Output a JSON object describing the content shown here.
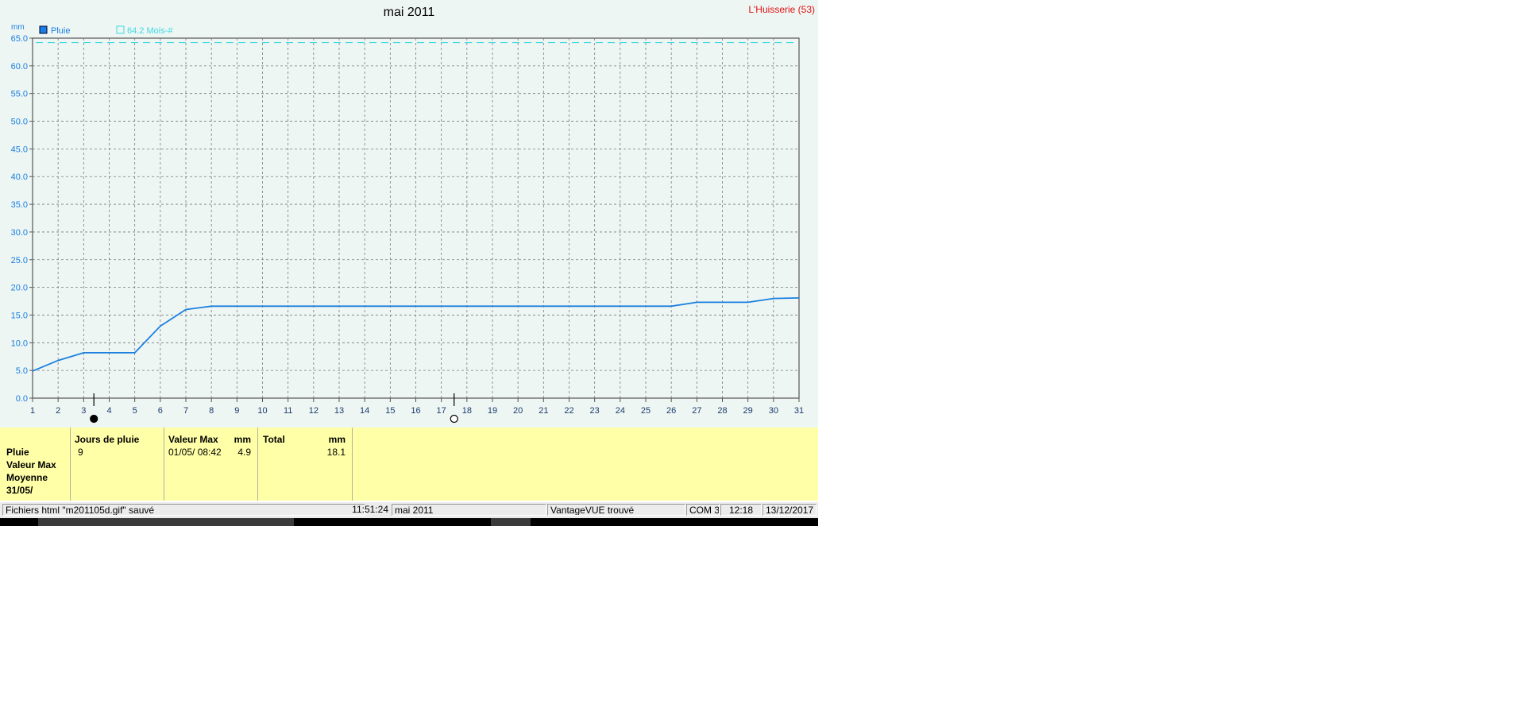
{
  "chart_data": {
    "type": "line",
    "title": "mai 2011",
    "station": "L'Huisserie (53)",
    "ylabel": "mm",
    "ylim": [
      0,
      65
    ],
    "xlim": [
      1,
      31
    ],
    "yticks": [
      "0.0",
      "5.0",
      "10.0",
      "15.0",
      "20.0",
      "25.0",
      "30.0",
      "35.0",
      "40.0",
      "45.0",
      "50.0",
      "55.0",
      "60.0",
      "65.0"
    ],
    "xticks": [
      "1",
      "2",
      "3",
      "4",
      "5",
      "6",
      "7",
      "8",
      "9",
      "10",
      "11",
      "12",
      "13",
      "14",
      "15",
      "16",
      "17",
      "18",
      "19",
      "20",
      "21",
      "22",
      "23",
      "24",
      "25",
      "26",
      "27",
      "28",
      "29",
      "30",
      "31"
    ],
    "grid": true,
    "series": [
      {
        "name": "Pluie",
        "color": "#1a7fe0",
        "x": [
          1,
          2,
          3,
          4,
          5,
          6,
          7,
          8,
          9,
          10,
          11,
          12,
          13,
          14,
          15,
          16,
          17,
          18,
          19,
          20,
          21,
          22,
          23,
          24,
          25,
          26,
          27,
          28,
          29,
          30,
          31
        ],
        "values": [
          4.9,
          6.8,
          8.2,
          8.2,
          8.2,
          13.0,
          16.0,
          16.6,
          16.6,
          16.6,
          16.6,
          16.6,
          16.6,
          16.6,
          16.6,
          16.6,
          16.6,
          16.6,
          16.6,
          16.6,
          16.6,
          16.6,
          16.6,
          16.6,
          16.6,
          16.6,
          17.3,
          17.3,
          17.3,
          18.0,
          18.1
        ]
      }
    ],
    "reference": {
      "label": "64.2 Mois-#",
      "value": 64.2,
      "color": "#3fd8e0"
    },
    "moon_markers": [
      {
        "x": 3.4,
        "phase": "new",
        "icon": "new-moon-icon"
      },
      {
        "x": 17.5,
        "phase": "full",
        "icon": "full-moon-icon"
      }
    ]
  },
  "stats": {
    "row_labels": [
      "Pluie",
      "Valeur Max",
      "Moyenne",
      "31/05/"
    ],
    "jours_header": "Jours de pluie",
    "jours_value": "9",
    "max_header": "Valeur Max",
    "max_unit": "mm",
    "max_date": "01/05/  08:42",
    "max_value": "4.9",
    "total_header": "Total",
    "total_unit": "mm",
    "total_value": "18.1"
  },
  "statusbar": {
    "message": "Fichiers html  \"m201105d.gif\"  sauvé",
    "time": "11:51:24",
    "period": "mai 2011",
    "device": "VantageVUE trouvé",
    "port": "COM 3",
    "clock": "12:18",
    "date": "13/12/2017"
  }
}
